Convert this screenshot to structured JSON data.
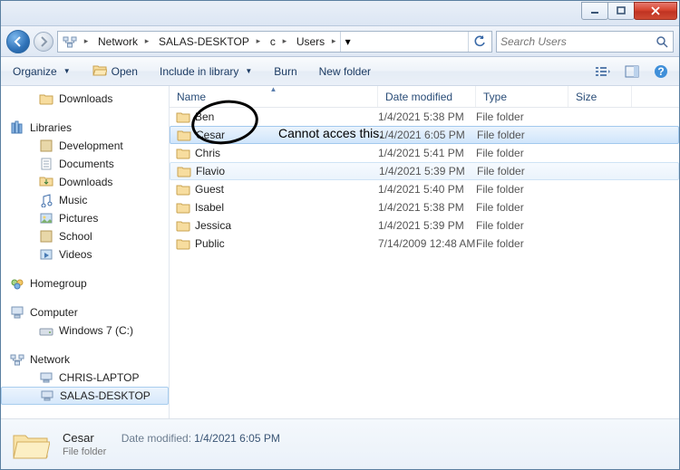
{
  "window": {
    "min_label": "Minimize",
    "max_label": "Maximize",
    "close_label": "Close"
  },
  "address": {
    "segments": [
      "Network",
      "SALAS-DESKTOP",
      "c",
      "Users"
    ],
    "search_placeholder": "Search Users"
  },
  "toolbar": {
    "organize": "Organize",
    "open": "Open",
    "include": "Include in library",
    "burn": "Burn",
    "newfolder": "New folder"
  },
  "nav": {
    "downloads": "Downloads",
    "libraries": "Libraries",
    "lib_items": [
      "Development",
      "Documents",
      "Downloads",
      "Music",
      "Pictures",
      "School",
      "Videos"
    ],
    "homegroup": "Homegroup",
    "computer": "Computer",
    "computer_items": [
      "Windows 7 (C:)"
    ],
    "network": "Network",
    "network_items": [
      "CHRIS-LAPTOP",
      "SALAS-DESKTOP"
    ]
  },
  "columns": {
    "name": "Name",
    "date": "Date modified",
    "type": "Type",
    "size": "Size"
  },
  "rows": [
    {
      "name": "Ben",
      "date": "1/4/2021 5:38 PM",
      "type": "File folder"
    },
    {
      "name": "Cesar",
      "date": "1/4/2021 6:05 PM",
      "type": "File folder"
    },
    {
      "name": "Chris",
      "date": "1/4/2021 5:41 PM",
      "type": "File folder"
    },
    {
      "name": "Flavio",
      "date": "1/4/2021 5:39 PM",
      "type": "File folder"
    },
    {
      "name": "Guest",
      "date": "1/4/2021 5:40 PM",
      "type": "File folder"
    },
    {
      "name": "Isabel",
      "date": "1/4/2021 5:38 PM",
      "type": "File folder"
    },
    {
      "name": "Jessica",
      "date": "1/4/2021 5:39 PM",
      "type": "File folder"
    },
    {
      "name": "Public",
      "date": "7/14/2009 12:48 AM",
      "type": "File folder"
    }
  ],
  "details": {
    "name": "Cesar",
    "type": "File folder",
    "date_label": "Date modified:",
    "date_value": "1/4/2021 6:05 PM"
  },
  "annotation": {
    "text": "Cannot acces this."
  }
}
